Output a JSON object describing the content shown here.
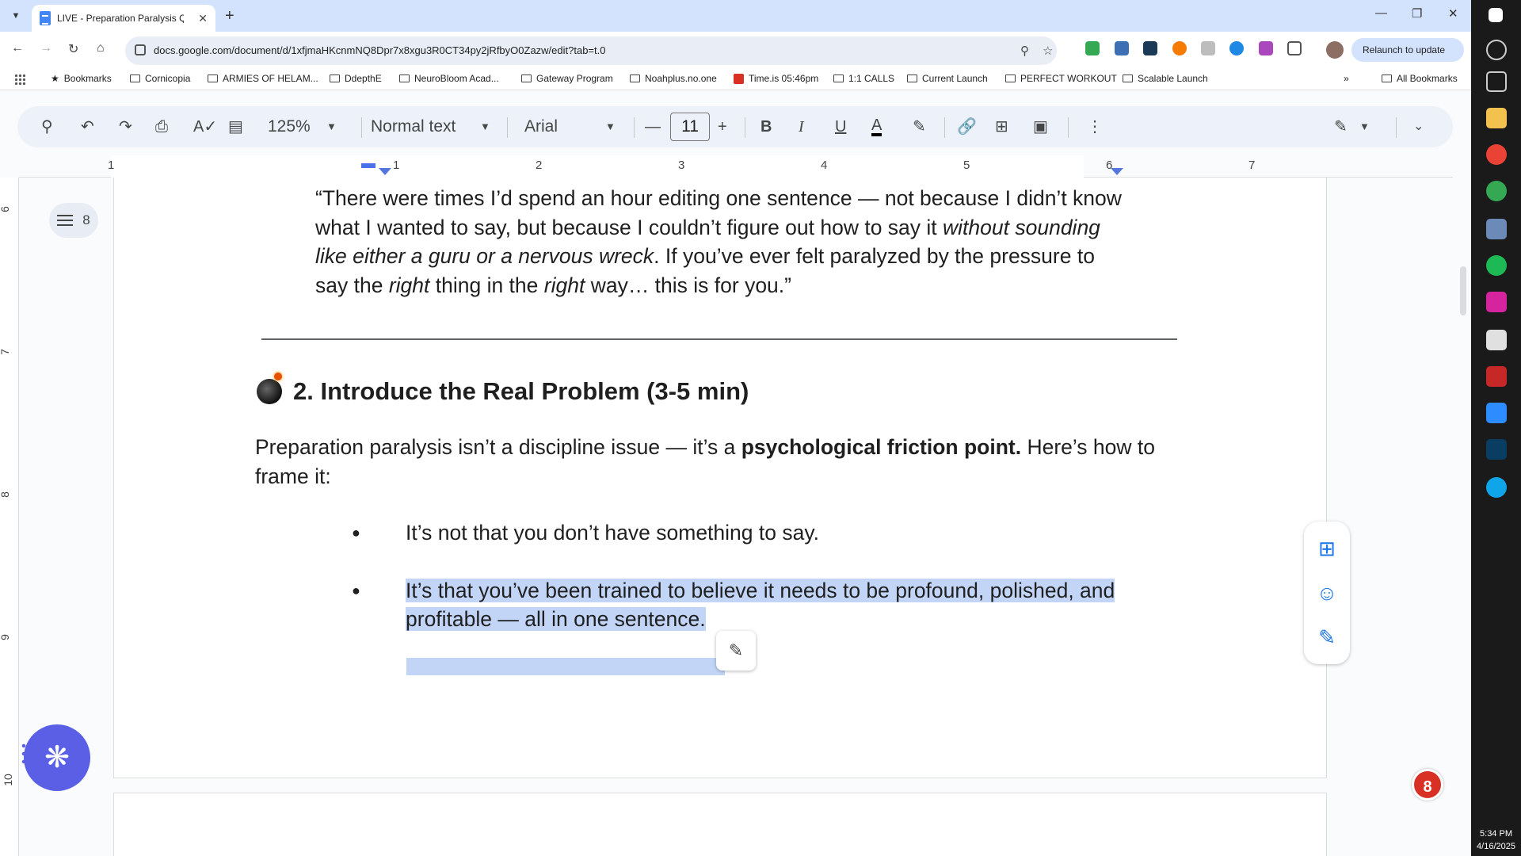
{
  "browser": {
    "tab_title": "LIVE - Preparation Paralysis Q&",
    "url": "docs.google.com/document/d/1xfjmaHKcnmNQ8Dpr7x8xgu3R0CT34py2jRfbyO0Zazw/edit?tab=t.0",
    "relaunch_label": "Relaunch to update"
  },
  "bookmarks": [
    "Bookmarks",
    "Cornicopia",
    "ARMIES OF HELAM...",
    "DdepthE",
    "NeuroBloom Acad...",
    "Gateway Program",
    "Noahplus.no.one",
    "Time.is 05:46pm",
    "1:1 CALLS",
    "Current Launch",
    "PERFECT WORKOUT",
    "Scalable Launch"
  ],
  "all_bookmarks": "All Bookmarks",
  "toolbar": {
    "zoom": "125%",
    "style": "Normal text",
    "font": "Arial",
    "font_size": "11"
  },
  "ruler": {
    "h_numbers": [
      "1",
      "1",
      "2",
      "3",
      "4",
      "5",
      "6",
      "7"
    ],
    "v_numbers": [
      "6",
      "7",
      "8",
      "9",
      "10"
    ]
  },
  "outline": {
    "count": "8"
  },
  "document": {
    "quote_a": "“There were times I’d spend an hour editing one sentence — not because I didn’t know what I wanted to say, but because I couldn’t figure out how to say it ",
    "quote_b_italic": "without sounding like either a guru or a nervous wreck",
    "quote_c": ". If you’ve ever felt paralyzed by the pressure to say the ",
    "quote_d_italic": "right",
    "quote_e": " thing in the ",
    "quote_f_italic": "right",
    "quote_g": " way… this is for you.”",
    "heading": "2. Introduce the Real Problem (3-5 min)",
    "para_a": "Preparation paralysis isn’t a discipline issue — it’s a ",
    "para_b_bold": "psychological friction point.",
    "para_c": " Here’s how to frame it:",
    "bullet1": "It’s not that you don’t have something to say.",
    "bullet2": "It’s that you’ve been trained to believe it needs to be profound, polished, and profitable — all in one sentence."
  },
  "notification_badge": "8",
  "taskbar": {
    "time": "5:34 PM",
    "date": "4/16/2025"
  },
  "icons": {
    "search": "search-icon",
    "undo": "undo-icon",
    "redo": "redo-icon",
    "print": "print-icon",
    "spellcheck": "spellcheck-icon",
    "paint_format": "paint-format-icon",
    "bold": "bold-icon",
    "italic": "italic-icon",
    "underline": "underline-icon",
    "text_color": "text-color-icon",
    "highlight": "highlight-icon",
    "link": "link-icon",
    "comment": "add-comment-icon",
    "image": "insert-image-icon",
    "more": "more-vert-icon",
    "edit_mode": "pencil-icon"
  },
  "colors": {
    "selection": "#c2d5f7",
    "accent": "#1a73e8",
    "gemini": "#5b5fe6",
    "badge": "#d93025"
  }
}
